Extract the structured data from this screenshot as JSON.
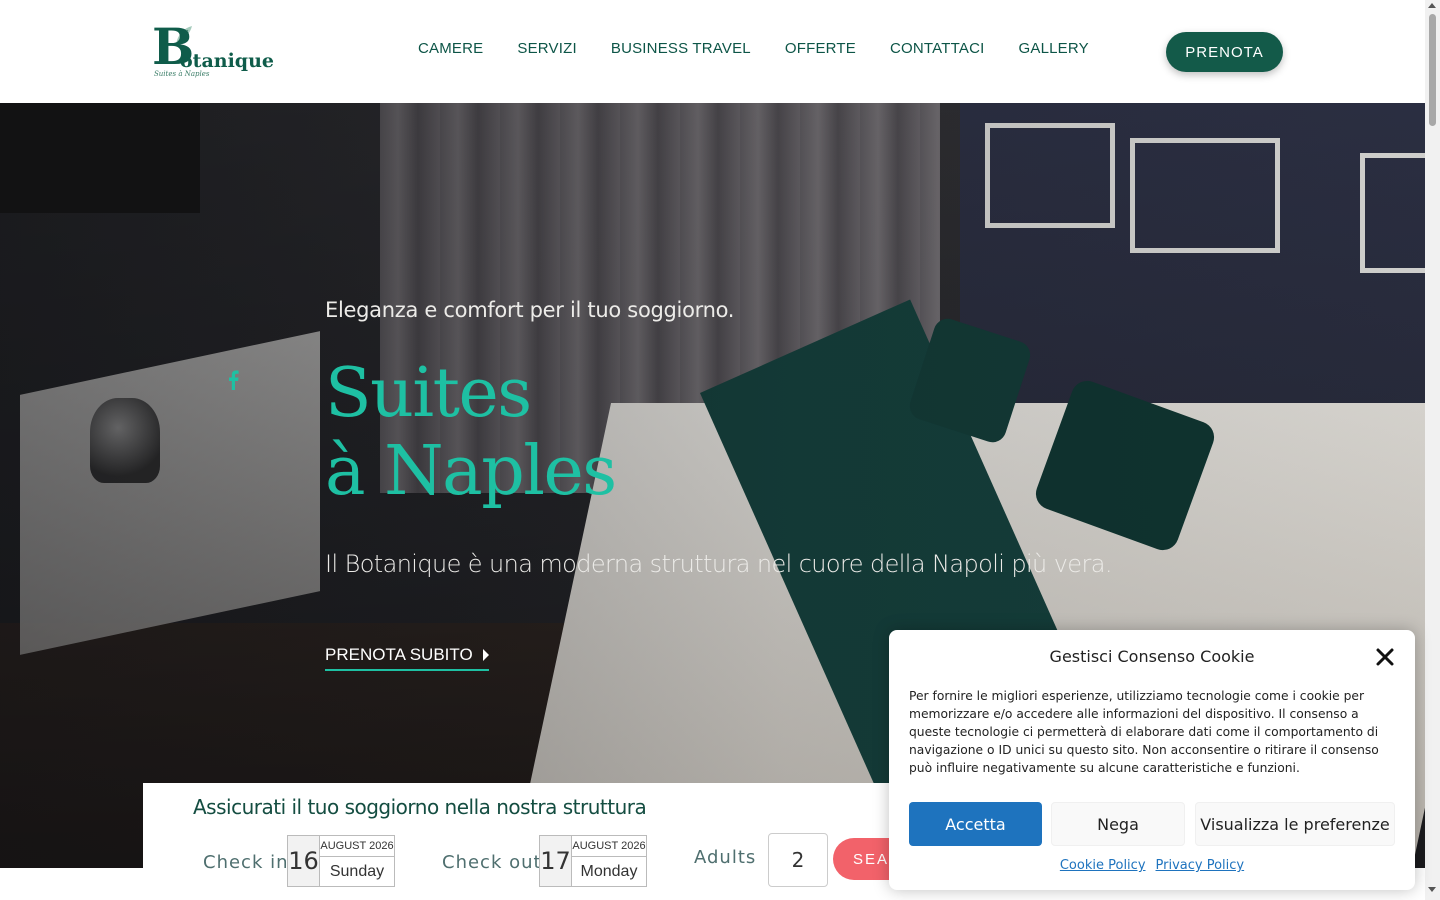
{
  "brand": {
    "logo_letter": "B",
    "logo_word": "otanique",
    "logo_tagline": "Suites à Naples",
    "color_primary": "#135a49",
    "color_accent": "#1ec0a3"
  },
  "nav": {
    "items": [
      "CAMERE",
      "SERVIZI",
      "BUSINESS TRAVEL",
      "OFFERTE",
      "CONTATTACI",
      "GALLERY"
    ],
    "cta_label": "PRENOTA"
  },
  "hero": {
    "eyebrow": "Eleganza e comfort per il tuo soggiorno.",
    "title_line1": "Suites",
    "title_line2": "à Naples",
    "subtitle": "Il Botanique è una moderna struttura nel cuore della Napoli più vera.",
    "cta_label": "PRENOTA SUBITO",
    "social_icon": "facebook-icon"
  },
  "booking": {
    "title": "Assicurati il tuo soggiorno nella nostra struttura",
    "checkin_label": "Check in",
    "checkin_day": "16",
    "checkin_month": "AUGUST 2026",
    "checkin_weekday": "Sunday",
    "checkout_label": "Check out",
    "checkout_day": "17",
    "checkout_month": "AUGUST 2026",
    "checkout_weekday": "Monday",
    "adults_label": "Adults",
    "adults_value": "2",
    "search_label": "SEARCH"
  },
  "cookie": {
    "title": "Gestisci Consenso Cookie",
    "text": "Per fornire le migliori esperienze, utilizziamo tecnologie come i cookie per memorizzare e/o accedere alle informazioni del dispositivo. Il consenso a queste tecnologie ci permetterà di elaborare dati come il comportamento di navigazione o ID unici su questo sito. Non acconsentire o ritirare il consenso può influire negativamente su alcune caratteristiche e funzioni.",
    "accept_label": "Accetta",
    "deny_label": "Nega",
    "prefs_label": "Visualizza le preferenze",
    "cookie_policy_label": "Cookie Policy",
    "privacy_policy_label": "Privacy Policy",
    "accept_color": "#1e73be"
  }
}
